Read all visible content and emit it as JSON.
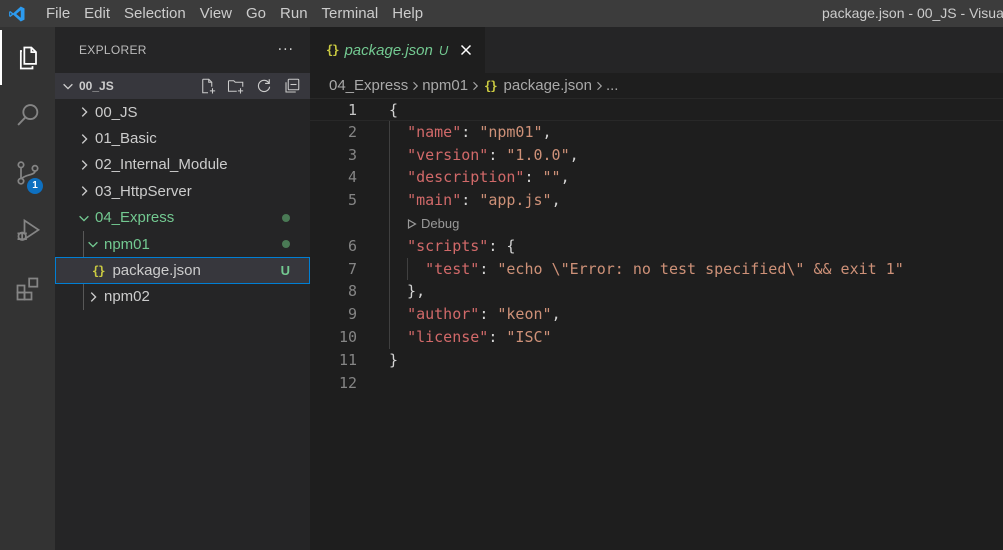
{
  "titlebar": {
    "menu": [
      "File",
      "Edit",
      "Selection",
      "View",
      "Go",
      "Run",
      "Terminal",
      "Help"
    ],
    "window_title": "package.json - 00_JS - Visua"
  },
  "activitybar": {
    "items": [
      {
        "name": "explorer",
        "icon": "files-icon"
      },
      {
        "name": "search",
        "icon": "search-icon"
      },
      {
        "name": "source-control",
        "icon": "source-control-icon",
        "badge": "1"
      },
      {
        "name": "run-debug",
        "icon": "run-debug-icon"
      },
      {
        "name": "extensions",
        "icon": "extensions-icon"
      }
    ]
  },
  "sidebar": {
    "title": "EXPLORER",
    "more": "···",
    "folder": "00_JS",
    "tree": [
      {
        "label": "00_JS",
        "type": "folder",
        "expanded": false
      },
      {
        "label": "01_Basic",
        "type": "folder",
        "expanded": false
      },
      {
        "label": "02_Internal_Module",
        "type": "folder",
        "expanded": false
      },
      {
        "label": "03_HttpServer",
        "type": "folder",
        "expanded": false
      },
      {
        "label": "04_Express",
        "type": "folder",
        "expanded": true
      },
      {
        "label": "npm01",
        "type": "folder",
        "expanded": true
      },
      {
        "label": "package.json",
        "type": "file",
        "status": "U"
      },
      {
        "label": "npm02",
        "type": "folder",
        "expanded": false
      }
    ]
  },
  "tab": {
    "icon": "{}",
    "label": "package.json",
    "status": "U"
  },
  "breadcrumb": [
    "04_Express",
    "npm01",
    "package.json",
    "..."
  ],
  "breadcrumb_icon": "{}",
  "editor": {
    "codelens": "Debug",
    "line_numbers": [
      "1",
      "2",
      "3",
      "4",
      "5",
      "6",
      "7",
      "8",
      "9",
      "10",
      "11",
      "12"
    ],
    "lines": [
      {
        "parts": [
          {
            "t": "{",
            "c": "pun"
          }
        ]
      },
      {
        "parts": [
          {
            "t": "  ",
            "c": "pun"
          },
          {
            "t": "\"name\"",
            "c": "key2"
          },
          {
            "t": ": ",
            "c": "pun"
          },
          {
            "t": "\"npm01\"",
            "c": "str"
          },
          {
            "t": ",",
            "c": "pun"
          }
        ]
      },
      {
        "parts": [
          {
            "t": "  ",
            "c": "pun"
          },
          {
            "t": "\"version\"",
            "c": "key2"
          },
          {
            "t": ": ",
            "c": "pun"
          },
          {
            "t": "\"1.0.0\"",
            "c": "str"
          },
          {
            "t": ",",
            "c": "pun"
          }
        ]
      },
      {
        "parts": [
          {
            "t": "  ",
            "c": "pun"
          },
          {
            "t": "\"description\"",
            "c": "key2"
          },
          {
            "t": ": ",
            "c": "pun"
          },
          {
            "t": "\"\"",
            "c": "str"
          },
          {
            "t": ",",
            "c": "pun"
          }
        ]
      },
      {
        "parts": [
          {
            "t": "  ",
            "c": "pun"
          },
          {
            "t": "\"main\"",
            "c": "key2"
          },
          {
            "t": ": ",
            "c": "pun"
          },
          {
            "t": "\"app.js\"",
            "c": "str"
          },
          {
            "t": ",",
            "c": "pun"
          }
        ]
      },
      {
        "parts": [
          {
            "t": "  ",
            "c": "pun"
          },
          {
            "t": "\"scripts\"",
            "c": "key2"
          },
          {
            "t": ": {",
            "c": "pun"
          }
        ]
      },
      {
        "parts": [
          {
            "t": "    ",
            "c": "pun"
          },
          {
            "t": "\"test\"",
            "c": "key2"
          },
          {
            "t": ": ",
            "c": "pun"
          },
          {
            "t": "\"echo \\\"Error: no test specified\\\" && exit 1\"",
            "c": "str"
          }
        ]
      },
      {
        "parts": [
          {
            "t": "  },",
            "c": "pun"
          }
        ]
      },
      {
        "parts": [
          {
            "t": "  ",
            "c": "pun"
          },
          {
            "t": "\"author\"",
            "c": "key2"
          },
          {
            "t": ": ",
            "c": "pun"
          },
          {
            "t": "\"keon\"",
            "c": "str"
          },
          {
            "t": ",",
            "c": "pun"
          }
        ]
      },
      {
        "parts": [
          {
            "t": "  ",
            "c": "pun"
          },
          {
            "t": "\"license\"",
            "c": "key2"
          },
          {
            "t": ": ",
            "c": "pun"
          },
          {
            "t": "\"ISC\"",
            "c": "str"
          }
        ]
      },
      {
        "parts": [
          {
            "t": "}",
            "c": "pun"
          }
        ]
      },
      {
        "parts": []
      }
    ]
  },
  "colors": {
    "accent": "#007fd4",
    "untracked": "#73c991",
    "json_icon": "#cbcb41",
    "badge": "#0e70c0"
  }
}
